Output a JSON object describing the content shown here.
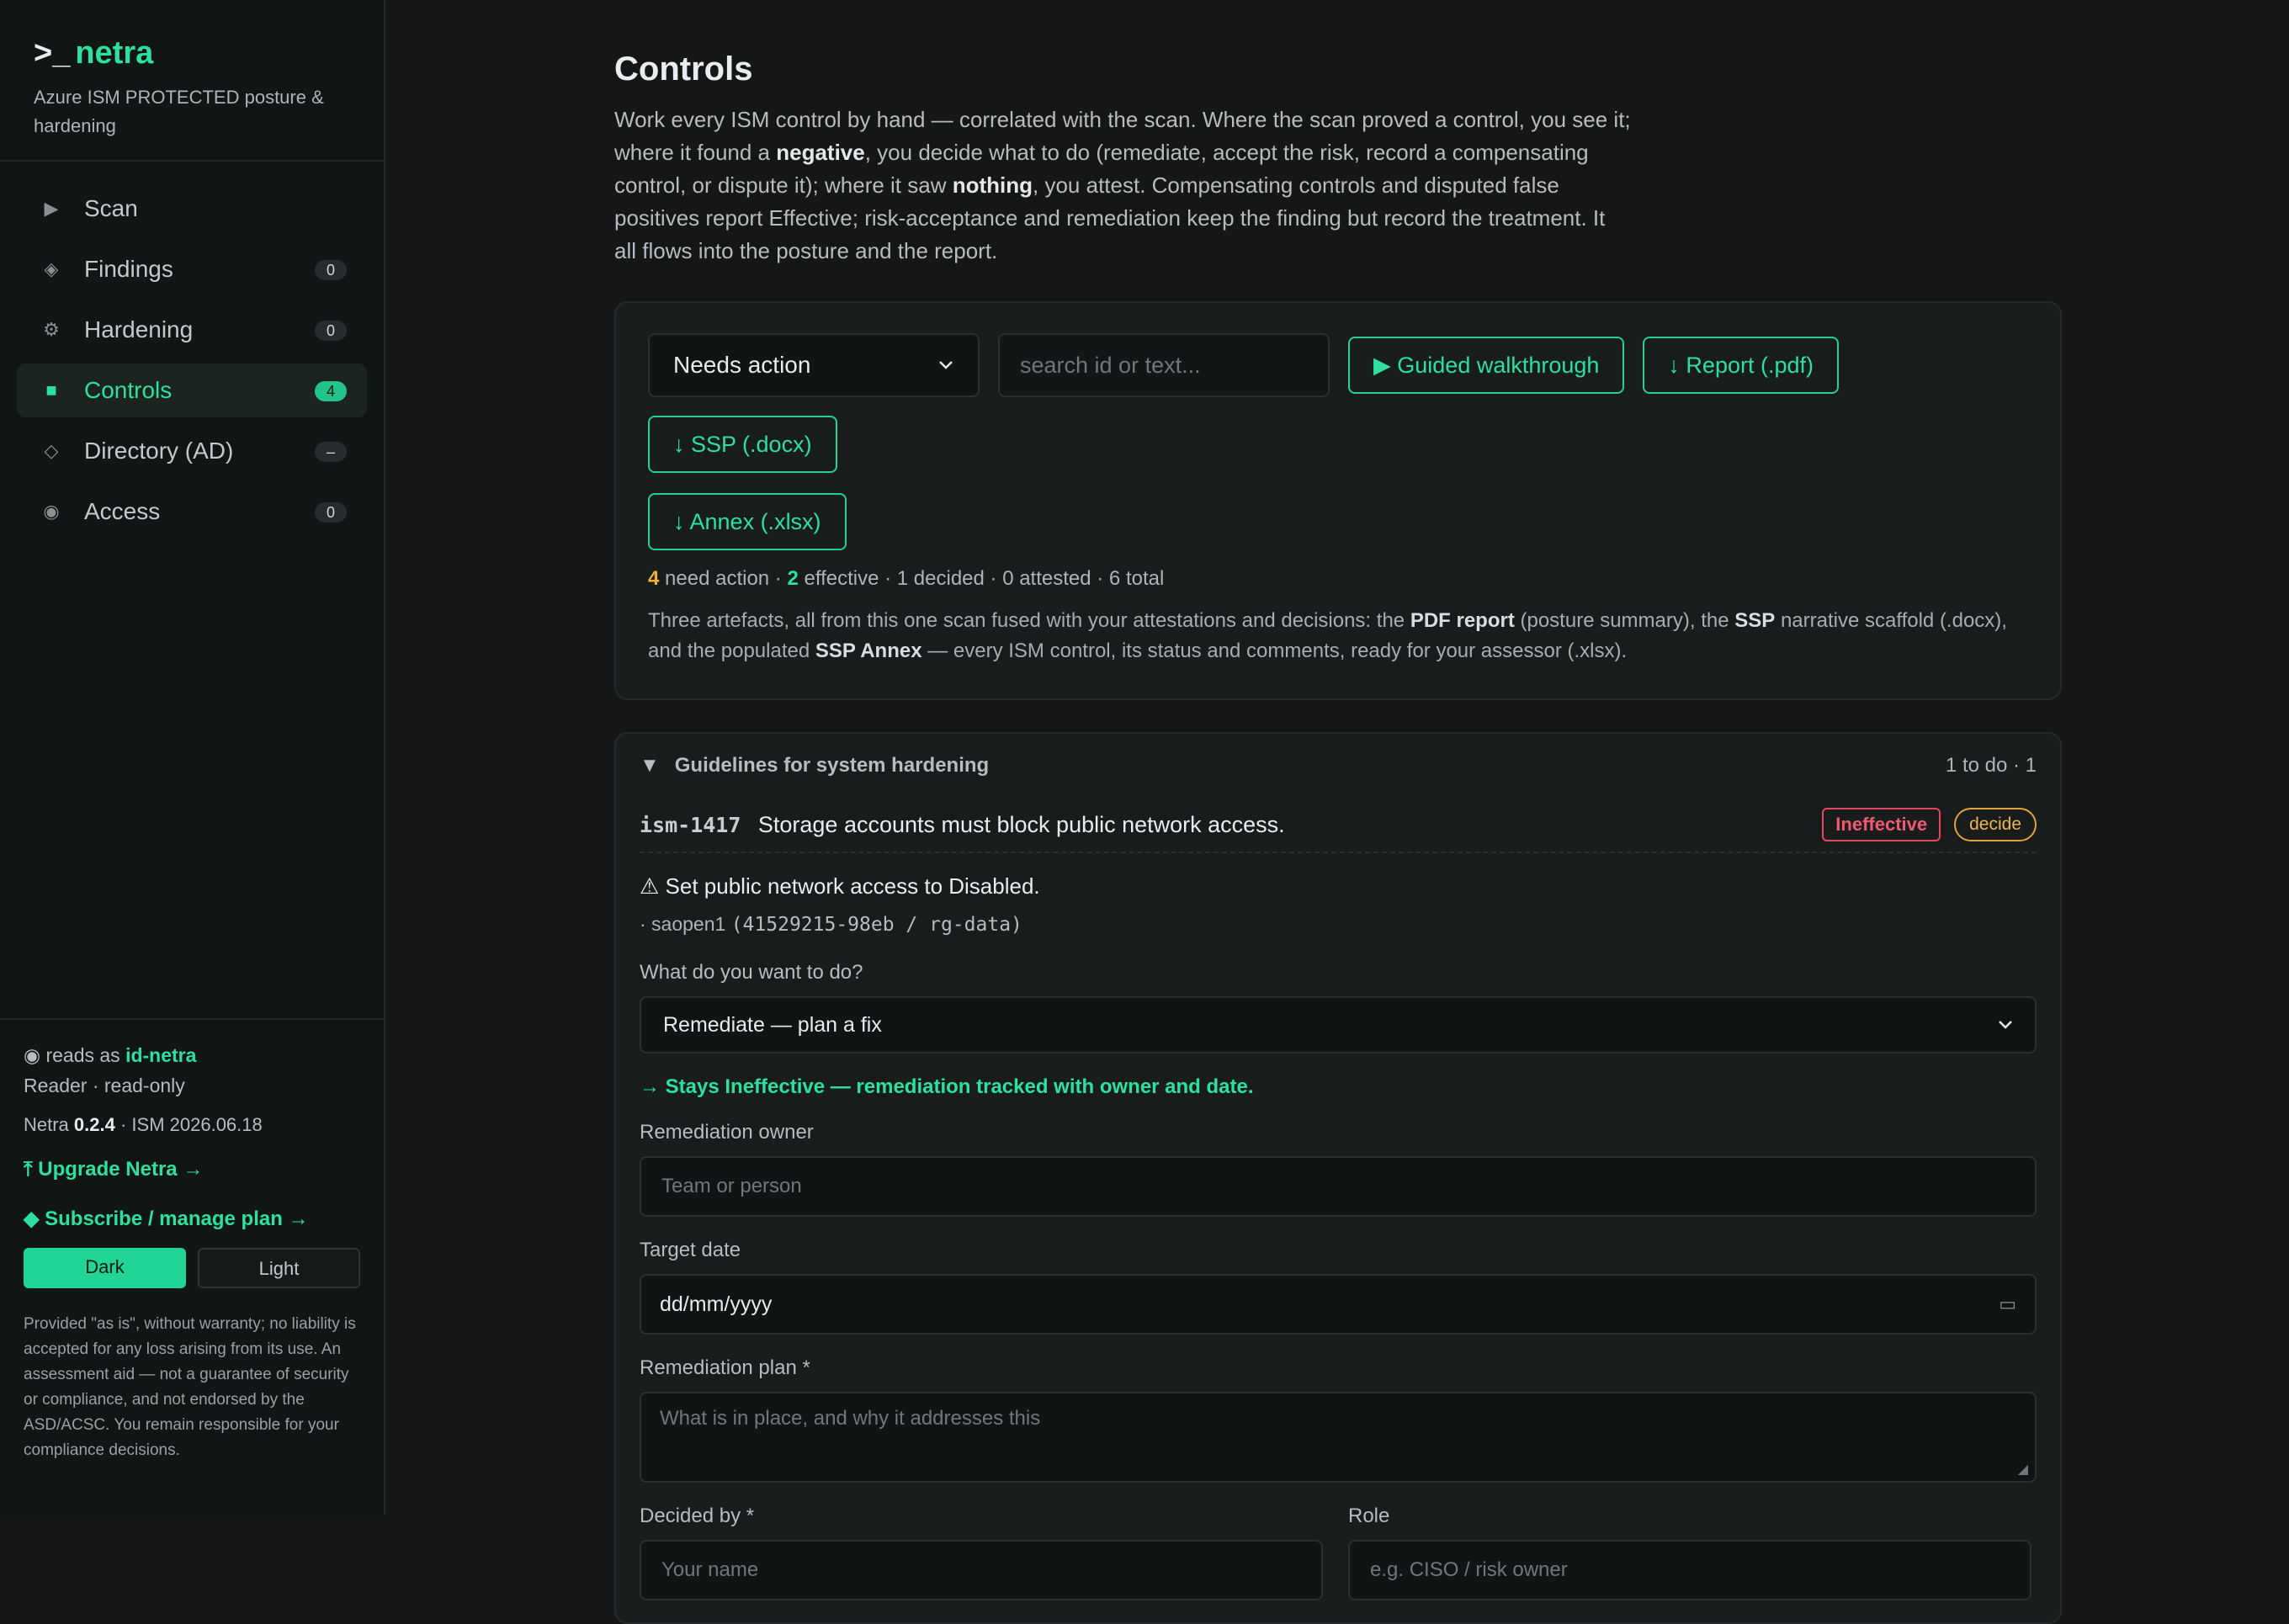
{
  "brand": {
    "prompt": ">_",
    "name": "netra",
    "subtitle": "Azure ISM PROTECTED posture & hardening"
  },
  "nav": [
    {
      "label": "Scan",
      "icon": "▶",
      "badge": ""
    },
    {
      "label": "Findings",
      "icon": "◈",
      "badge": "0"
    },
    {
      "label": "Hardening",
      "icon": "⚙",
      "badge": "0"
    },
    {
      "label": "Controls",
      "icon": "■",
      "badge": "4"
    },
    {
      "label": "Directory (AD)",
      "icon": "◇",
      "badge": "–"
    },
    {
      "label": "Access",
      "icon": "◉",
      "badge": "0"
    }
  ],
  "footer": {
    "reads_icon": "◉",
    "reads_prefix": "reads as",
    "reads_id": "id-netra",
    "role": "Reader · read-only",
    "version_prefix": "Netra",
    "version": "0.2.4",
    "version_suffix": "· ISM 2026.06.18",
    "upgrade": "⤒ Upgrade Netra →",
    "subscribe": "◆ Subscribe / manage plan →",
    "theme_dark": "Dark",
    "theme_light": "Light",
    "disclaimer": "Provided \"as is\", without warranty; no liability is accepted for any loss arising from its use. An assessment aid — not a guarantee of security or compliance, and not endorsed by the ASD/ACSC. You remain responsible for your compliance decisions."
  },
  "page": {
    "title": "Controls",
    "intro_1": "Work every ISM control by hand — correlated with the scan. Where the scan proved a control, you see it; where it found a ",
    "intro_b1": "negative",
    "intro_2": ", you decide what to do (remediate, accept the risk, record a compensating control, or dispute it); where it saw ",
    "intro_b2": "nothing",
    "intro_3": ", you attest. Compensating controls and disputed false positives report Effective; risk-acceptance and remediation keep the finding but record the treatment. It all flows into the posture and the report."
  },
  "toolbar": {
    "filter_value": "Needs action",
    "search_placeholder": "search id or text...",
    "walkthrough": "▶ Guided walkthrough",
    "report": "↓ Report (.pdf)",
    "ssp": "↓ SSP (.docx)",
    "annex": "↓ Annex (.xlsx)"
  },
  "stats": {
    "need_action": "4",
    "need_action_label": "need action ·",
    "effective": "2",
    "effective_label": "effective · 1 decided · 0 attested · 6 total"
  },
  "artefacts": {
    "t1": "Three artefacts, all from this one scan fused with your attestations and decisions: the ",
    "b1": "PDF report",
    "t2": " (posture summary), the ",
    "b2": "SSP",
    "t3": " narrative scaffold (.docx), and the populated ",
    "b3": "SSP Annex",
    "t4": " — every ISM control, its status and comments, ready for your assessor (.xlsx)."
  },
  "section": {
    "title": "Guidelines for system hardening",
    "count": "1 to do · 1",
    "control_id": "ism-1417",
    "control_text": "Storage accounts must block public network access.",
    "status": "Ineffective",
    "action": "decide",
    "warning": "⚠ Set public network access to Disabled.",
    "resource_prefix": "· saopen1",
    "resource_detail": "(41529215-98eb / rg-data)",
    "question": "What do you want to do?",
    "decision": "Remediate — plan a fix",
    "note": "→ Stays Ineffective — remediation tracked with owner and date.",
    "owner_label": "Remediation owner",
    "owner_placeholder": "Team or person",
    "date_label": "Target date",
    "date_value": "dd/mm/yyyy",
    "plan_label": "Remediation plan *",
    "plan_placeholder": "What is in place, and why it addresses this",
    "decided_label": "Decided by *",
    "decided_placeholder": "Your name",
    "role_label": "Role",
    "role_placeholder": "e.g. CISO / risk owner"
  }
}
